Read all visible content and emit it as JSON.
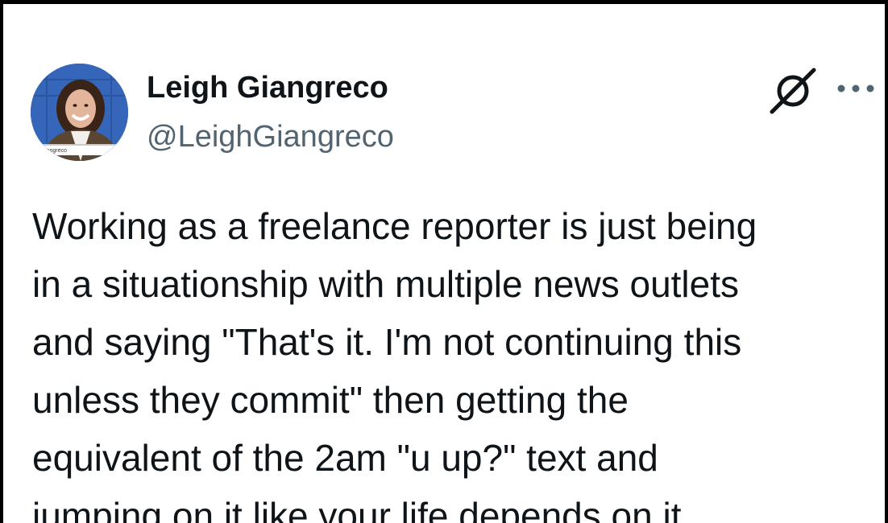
{
  "author": {
    "display_name": "Leigh Giangreco",
    "handle": "@LeighGiangreco",
    "avatar_icon": "profile-photo",
    "avatar_caption": "iangreco"
  },
  "header_icons": {
    "grok": "grok-icon",
    "more": "more-options-icon"
  },
  "tweet": {
    "lines": [
      "Working as a freelance reporter is just being",
      "in a situationship with multiple news outlets",
      "and saying \"That's it. I'm not continuing this",
      "unless they commit\" then getting the",
      "equivalent of the 2am \"u up?\" text and",
      "jumping on it like your life depends on it"
    ]
  },
  "colors": {
    "text_primary": "#0f1419",
    "text_secondary": "#536471",
    "frame": "#000000",
    "background": "#ffffff"
  }
}
